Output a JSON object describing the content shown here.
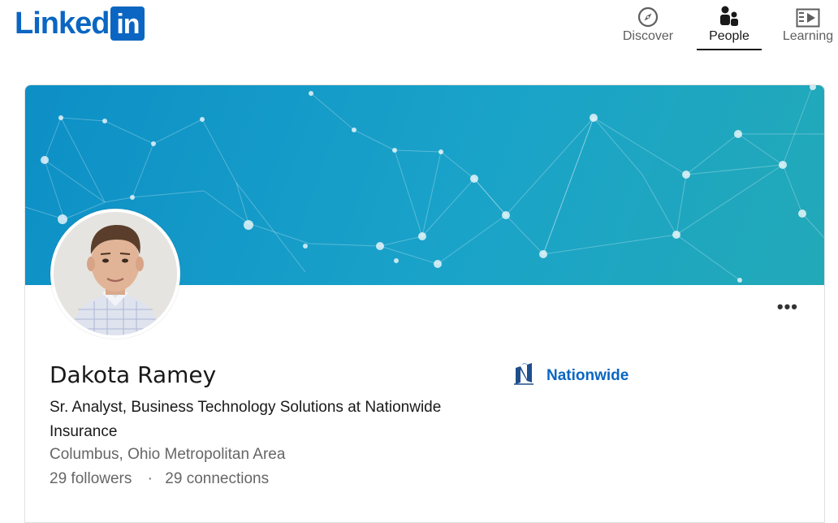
{
  "header": {
    "logo_text": "Linked",
    "logo_box": "in",
    "nav": [
      {
        "label": "Discover",
        "icon": "compass-icon"
      },
      {
        "label": "People",
        "icon": "people-icon",
        "active": true
      },
      {
        "label": "Learning",
        "icon": "video-icon"
      }
    ]
  },
  "profile": {
    "name": "Dakota Ramey",
    "headline": "Sr. Analyst, Business Technology Solutions at Nationwide Insurance",
    "location": "Columbus, Ohio Metropolitan Area",
    "followers": "29 followers",
    "separator": "·",
    "connections": "29 connections",
    "company": "Nationwide",
    "more_label": "•••"
  },
  "colors": {
    "brand": "#0a66c2",
    "cover_start": "#0d8fc6",
    "cover_end": "#22a9b8"
  }
}
